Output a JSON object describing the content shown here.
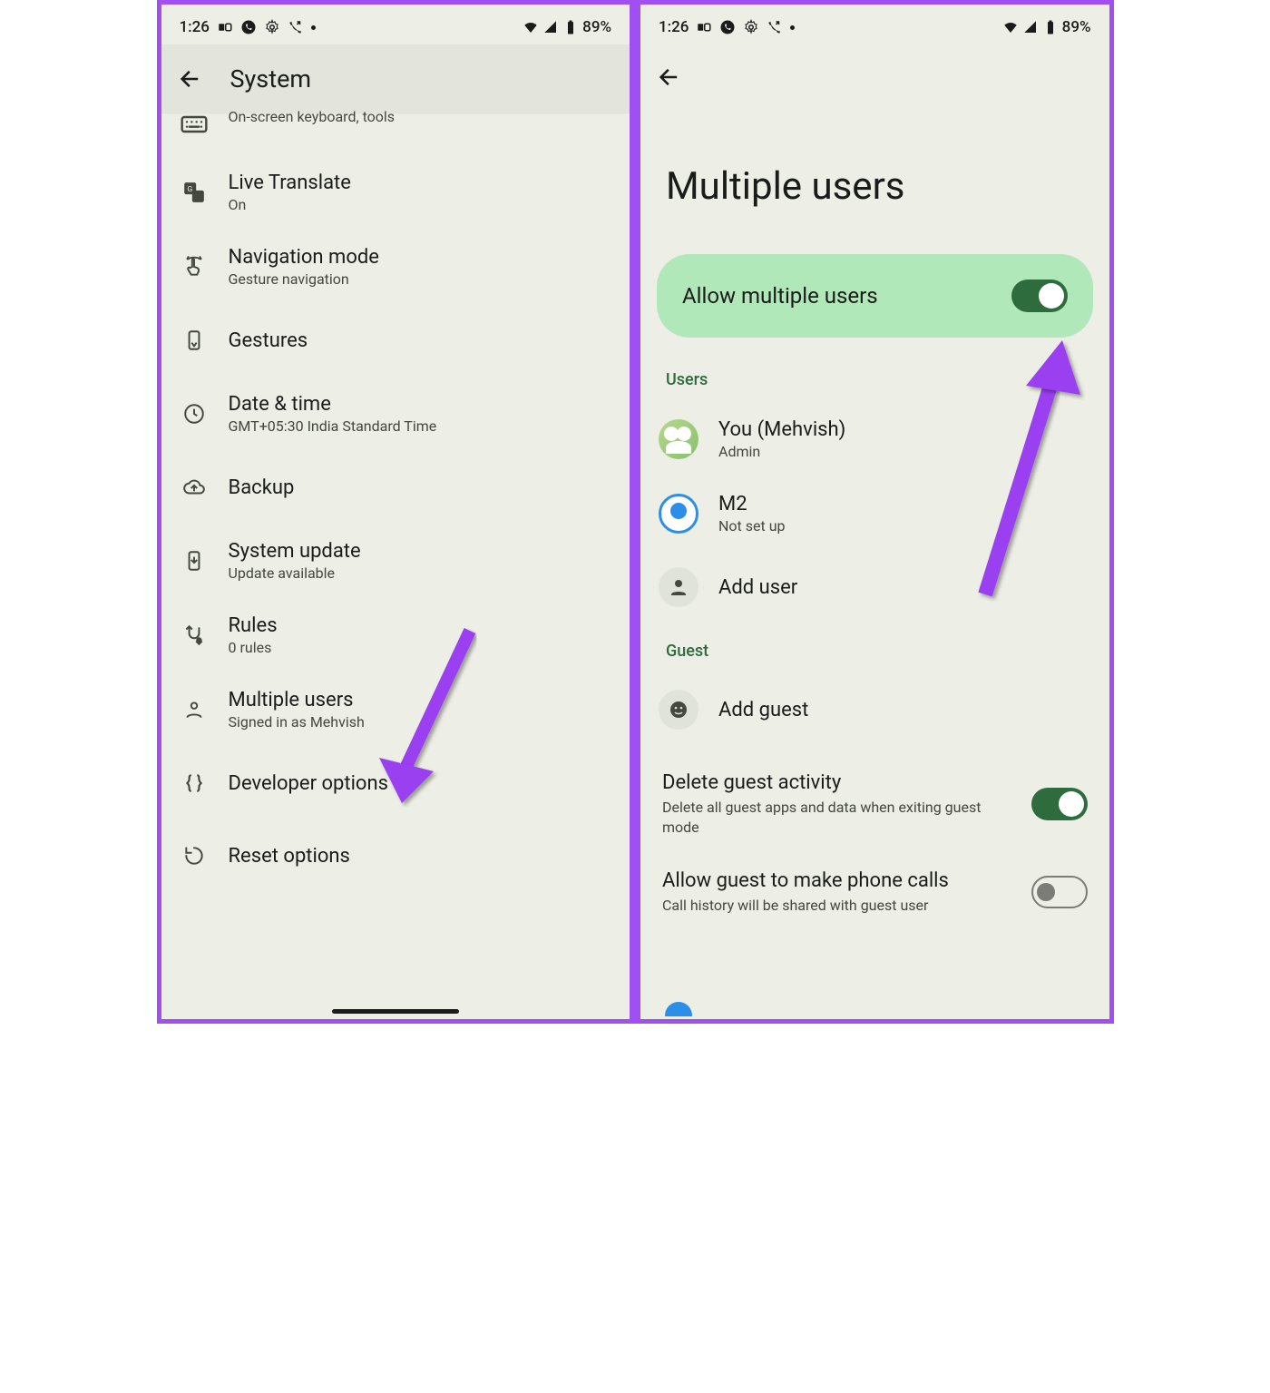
{
  "status": {
    "time": "1:26",
    "battery": "89%"
  },
  "phone1": {
    "appbar_title": "System",
    "keyboard_sub": "On-screen keyboard, tools",
    "items": [
      {
        "title": "Live Translate",
        "sub": "On"
      },
      {
        "title": "Navigation mode",
        "sub": "Gesture navigation"
      },
      {
        "title": "Gestures",
        "sub": ""
      },
      {
        "title": "Date & time",
        "sub": "GMT+05:30 India Standard Time"
      },
      {
        "title": "Backup",
        "sub": ""
      },
      {
        "title": "System update",
        "sub": "Update available"
      },
      {
        "title": "Rules",
        "sub": "0 rules"
      },
      {
        "title": "Multiple users",
        "sub": "Signed in as Mehvish"
      },
      {
        "title": "Developer options",
        "sub": ""
      },
      {
        "title": "Reset options",
        "sub": ""
      }
    ]
  },
  "phone2": {
    "page_title": "Multiple users",
    "allow_label": "Allow multiple users",
    "section_users": "Users",
    "section_guest": "Guest",
    "user_you_title": "You (Mehvish)",
    "user_you_sub": "Admin",
    "user_m2_title": "M2",
    "user_m2_sub": "Not set up",
    "add_user": "Add user",
    "add_guest": "Add guest",
    "delete_guest_title": "Delete guest activity",
    "delete_guest_sub": "Delete all guest apps and data when exiting guest mode",
    "allow_calls_title": "Allow guest to make phone calls",
    "allow_calls_sub": "Call history will be shared with guest user"
  },
  "colors": {
    "annotation_arrow": "#9a3ff0"
  }
}
